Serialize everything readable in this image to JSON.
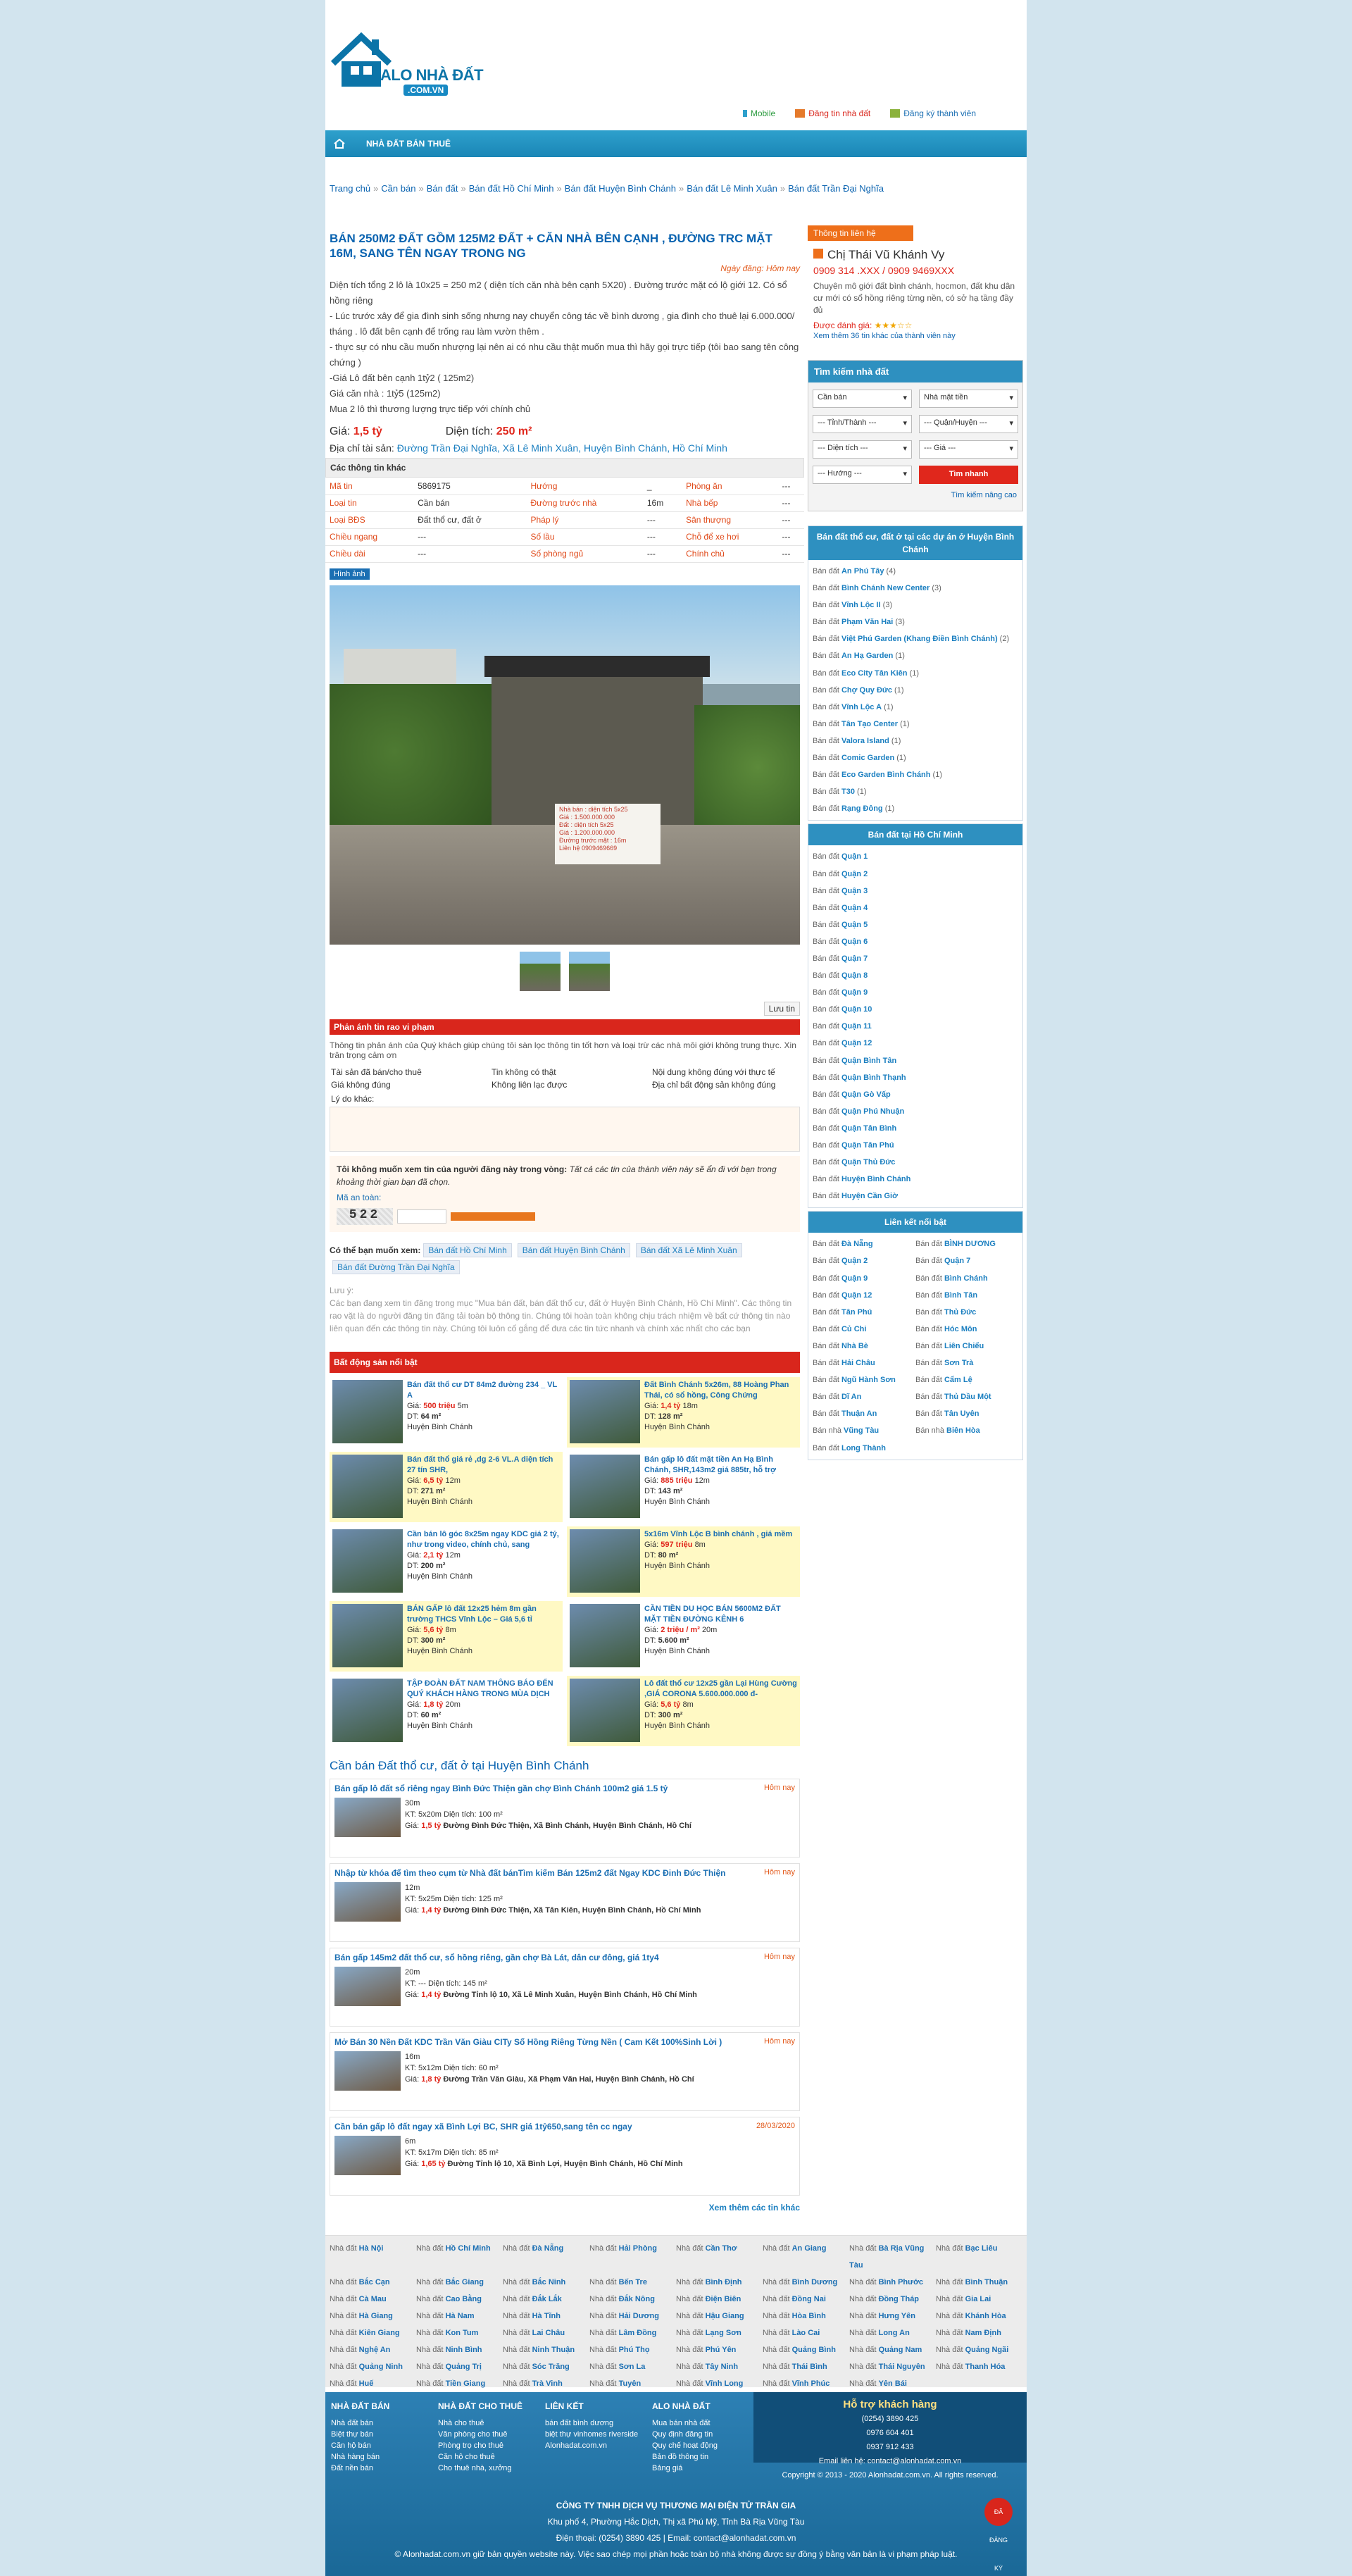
{
  "header": {
    "logo_top": "ALO NHÀ ĐẤT",
    "logo_bottom": ".COM.VN",
    "links": [
      "Mobile",
      "Đăng tin nhà đất",
      "Đăng ký thành viên"
    ]
  },
  "nav": {
    "home_icon": "home-icon",
    "items": [
      "NHÀ ĐẤT BÁN",
      "THUÊ"
    ]
  },
  "breadcrumb": [
    "Trang chủ",
    "Cần bán",
    "Bán đất",
    "Bán đất Hồ Chí Minh",
    "Bán đất Huyện Bình Chánh",
    "Bán đất Lê Minh Xuân",
    "Bán đất Trần Đại Nghĩa"
  ],
  "listing": {
    "title": "BÁN 250M2 ĐẤT GỒM 125M2 ĐẤT + CĂN NHÀ BÊN CẠNH , ĐƯỜNG TRC MẶT 16M, SANG TÊN NGAY TRONG NG",
    "date": "Ngày đăng: Hôm nay",
    "desc": [
      "Diện tích tổng 2 lô là 10x25 = 250 m2 ( diện tích căn nhà bên cạnh 5X20) . Đường trước mặt có lộ giới 12. Có sổ hồng riêng",
      "- Lúc trước xây để gia đình sinh sống nhưng nay chuyển công tác về bình dương , gia đình cho thuê lại 6.000.000/ tháng . lô đất bên cạnh để trống rau làm vườn thêm .",
      "- thực sự có nhu cầu muốn nhượng lại nên ai có nhu cầu thật muốn mua thì hãy gọi trực tiếp (tôi bao sang tên công chứng )",
      "-Giá Lô đất bên cạnh 1tỷ2 ( 125m2)",
      "Giá căn nhà : 1tỷ5 (125m2)",
      "Mua 2 lô thì thương lượng trực tiếp với chính chủ"
    ],
    "price_label": "Giá:",
    "price": "1,5 tỷ",
    "area_label": "Diện tích:",
    "area": "250 m²",
    "addr_label": "Địa chỉ tài sản:",
    "addr": "Đường Trần Đại Nghĩa, Xã Lê Minh Xuân, Huyện Bình Chánh, Hồ Chí Minh",
    "info_title": "Các thông tin khác",
    "info": [
      [
        "Mã tin",
        "5869175",
        "Hướng",
        "_",
        "Phòng ăn",
        "---"
      ],
      [
        "Loại tin",
        "Cần bán",
        "Đường trước nhà",
        "16m",
        "Nhà bếp",
        "---"
      ],
      [
        "Loại BĐS",
        "Đất thổ cư, đất ở",
        "Pháp lý",
        "---",
        "Sân thượng",
        "---"
      ],
      [
        "Chiều ngang",
        "---",
        "Số lầu",
        "---",
        "Chỗ để xe hơi",
        "---"
      ],
      [
        "Chiều dài",
        "---",
        "Số phòng ngủ",
        "---",
        "Chính chủ",
        "---"
      ]
    ],
    "photo_label": "Hình ảnh",
    "sign": [
      "Nhà bán : diện tích 5x25",
      "Giá : 1.500.000.000",
      "Đất : diện tích 5x25",
      "Giá : 1.200.000.000",
      "Đường trước mặt : 16m",
      "Liên hệ 0909469669"
    ],
    "save": "Lưu tin"
  },
  "report": {
    "title": "Phản ánh tin rao vi phạm",
    "intro": "Thông tin phản ánh của Quý khách giúp chúng tôi sàn lọc thông tin tốt hơn và loại trừ các nhà môi giới không trung thực. Xin trân trọng cảm ơn",
    "options": [
      "Tài sản đã bán/cho thuê",
      "Tin không có thật",
      "Nội dung không đúng với thực tế",
      "Giá không đúng",
      "Không liên lạc được",
      "Địa chỉ bất động sản không đúng"
    ],
    "reason_label": "Lý do khác:",
    "block_title": "Tôi không muốn xem tin của người đăng này trong vòng:",
    "block_note": "Tất cả các tin của thành viên này sẽ ẩn đi với bạn trong khoảng thời gian bạn đã chọn.",
    "cap_label": "Mã an toàn:",
    "cap": "522"
  },
  "seealso": {
    "label": "Có thể bạn muốn xem:",
    "tags": [
      "Bán đất Hồ Chí Minh",
      "Bán đất Huyện Bình Chánh",
      "Bán đất Xã Lê Minh Xuân",
      "Bán đất Đường Trần Đại Nghĩa"
    ]
  },
  "note": {
    "title": "Lưu ý:",
    "text": "Các bạn đang xem tin đăng trong mục \"Mua bán đất, bán đất thổ cư, đất ở Huyện Bình Chánh, Hồ Chí Minh\". Các thông tin rao vặt là do người đăng tin đăng tải toàn bộ thông tin. Chúng tôi hoàn toàn không chịu trách nhiệm về bất cứ thông tin nào liên quan đến các thông tin này. Chúng tôi luôn cố gắng để đưa các tin tức nhanh và chính xác nhất cho các bạn"
  },
  "hot": {
    "title": "Bất động sản nổi bật",
    "items": [
      {
        "t": "Bán đất thổ cư DT 84m2 đường 234 _ VL A",
        "p": "500 triệu",
        "a": "64 m²",
        "s": "5m",
        "l": "Huyện Bình Chánh",
        "y": false
      },
      {
        "t": "Đất Bình Chánh 5x26m, 88 Hoàng Phan Thái, có sổ hồng, Công Chứng",
        "p": "1,4 tỷ",
        "a": "128 m²",
        "s": "18m",
        "l": "Huyện Bình Chánh",
        "y": true
      },
      {
        "t": "Bán đất thổ giá rẻ ,dg 2-6 VL.A diện tích 27 tín SHR,",
        "p": "6,5 tỷ",
        "a": "271 m²",
        "s": "12m",
        "l": "Huyện Bình Chánh",
        "y": true
      },
      {
        "t": "Bán gấp lô đất mặt tiền An Hạ Bình Chánh, SHR,143m2 giá 885tr, hỗ trợ",
        "p": "885 triệu",
        "a": "143 m²",
        "s": "12m",
        "l": "Huyện Bình Chánh",
        "y": false
      },
      {
        "t": "Cần bán lô góc 8x25m ngay KDC giá 2 tỷ, như trong video, chính chủ, sang",
        "p": "2,1 tỷ",
        "a": "200 m²",
        "s": "12m",
        "l": "Huyện Bình Chánh",
        "y": false
      },
      {
        "t": "5x16m Vĩnh Lộc B bình chánh , giá mềm",
        "p": "597 triệu",
        "a": "80 m²",
        "s": "8m",
        "l": "Huyện Bình Chánh",
        "y": true
      },
      {
        "t": "BÁN GẤP lô đất 12x25 hẻm 8m gần trường THCS Vĩnh Lộc – Giá 5,6 tỉ",
        "p": "5,6 tỷ",
        "a": "300 m²",
        "s": "8m",
        "l": "Huyện Bình Chánh",
        "y": true
      },
      {
        "t": "CẦN TIỀN DU HỌC BÁN 5600M2 ĐẤT MẶT TIỀN ĐƯỜNG KÊNH 6",
        "p": "2 triệu / m²",
        "a": "5.600 m²",
        "s": "20m",
        "l": "Huyện Bình Chánh",
        "y": false
      },
      {
        "t": "TẬP ĐOÀN ĐẤT NAM THÔNG BÁO ĐẾN QUÝ KHÁCH HÀNG TRONG MÙA DỊCH",
        "p": "1,8 tỷ",
        "a": "60 m²",
        "s": "20m",
        "l": "Huyện Bình Chánh",
        "y": false
      },
      {
        "t": "Lô đất thổ cư 12x25 gần Lại Hùng Cường ,GIÁ CORONA 5.600.000.000 đ-",
        "p": "5,6 tỷ",
        "a": "300 m²",
        "s": "8m",
        "l": "Huyện Bình Chánh",
        "y": true
      }
    ]
  },
  "recent": {
    "title": "Cần bán Đất thổ cư, đất ở tại Huyện Bình Chánh",
    "items": [
      {
        "t": "Bán gấp lô đất sổ riêng ngay Bình Đức Thiện gần chợ Bình Chánh 100m2 giá 1.5 tỷ",
        "d": "Hôm nay",
        "kt": "5x20m",
        "dt": "100 m²",
        "g": "1,5 tỷ",
        "f": "30m",
        "h": "_",
        "addr": "Đường Đình Đức Thiện, Xã Bình Chánh, Huyện Bình Chánh, Hồ Chí"
      },
      {
        "t": "Nhập từ khóa để tìm theo cụm từ Nhà đất bánTìm kiếm Bán 125m2 đất Ngay KDC Đinh Đức Thiện",
        "d": "Hôm nay",
        "kt": "5x25m",
        "dt": "125 m²",
        "g": "1,4 tỷ",
        "f": "12m",
        "h": "_",
        "addr": "Đường Đinh Đức Thiện, Xã Tân Kiên, Huyện Bình Chánh, Hồ Chí Minh"
      },
      {
        "t": "Bán gấp 145m2 đất thổ cư, sổ hồng riêng, gần chợ Bà Lát, dân cư đông, giá 1ty4",
        "d": "Hôm nay",
        "kt": "---",
        "dt": "145 m²",
        "g": "1,4 tỷ",
        "f": "20m",
        "h": "_",
        "addr": "Đường Tỉnh lộ 10, Xã Lê Minh Xuân, Huyện Bình Chánh, Hồ Chí Minh"
      },
      {
        "t": "Mở Bán 30 Nền Đất KDC Trần Văn Giàu CITy Sổ Hồng Riêng Từng Nền ( Cam Kết 100%Sinh Lời )",
        "d": "Hôm nay",
        "kt": "5x12m",
        "dt": "60 m²",
        "g": "1,8 tỷ",
        "f": "16m",
        "h": "_",
        "addr": "Đường Trần Văn Giàu, Xã Phạm Văn Hai, Huyện Bình Chánh, Hồ Chí"
      },
      {
        "t": "Cần bán gấp lô đất ngay xã Bình Lợi BC, SHR giá 1tỷ650,sang tên cc ngay",
        "d": "28/03/2020",
        "kt": "5x17m",
        "dt": "85 m²",
        "g": "1,65 tỷ",
        "f": "6m",
        "h": "_",
        "addr": "Đường Tỉnh lộ 10, Xã Bình Lợi, Huyện Bình Chánh, Hồ Chí Minh"
      }
    ],
    "more": "Xem thêm các tin khác"
  },
  "cities": [
    "Hà Nội",
    "Hồ Chí Minh",
    "Đà Nẵng",
    "Hải Phòng",
    "Cần Thơ",
    "An Giang",
    "Bà Rịa Vũng Tàu",
    "Bạc Liêu",
    "Bắc Cạn",
    "Bắc Giang",
    "Bắc Ninh",
    "Bến Tre",
    "Bình Định",
    "Bình Dương",
    "Bình Phước",
    "Bình Thuận",
    "Cà Mau",
    "Cao Bằng",
    "Đắk Lắk",
    "Đắk Nông",
    "Điện Biên",
    "Đồng Nai",
    "Đồng Tháp",
    "Gia Lai",
    "Hà Giang",
    "Hà Nam",
    "Hà Tĩnh",
    "Hải Dương",
    "Hậu Giang",
    "Hòa Bình",
    "Hưng Yên",
    "Khánh Hòa",
    "Kiên Giang",
    "Kon Tum",
    "Lai Châu",
    "Lâm Đồng",
    "Lạng Sơn",
    "Lào Cai",
    "Long An",
    "Nam Định",
    "Nghệ An",
    "Ninh Bình",
    "Ninh Thuận",
    "Phú Thọ",
    "Phú Yên",
    "Quảng Bình",
    "Quảng Nam",
    "Quảng Ngãi",
    "Quảng Ninh",
    "Quảng Trị",
    "Sóc Trăng",
    "Sơn La",
    "Tây Ninh",
    "Thái Bình",
    "Thái Nguyên",
    "Thanh Hóa",
    "Huế",
    "Tiền Giang",
    "Trà Vinh",
    "Tuyên",
    "Vĩnh Long",
    "Vĩnh Phúc",
    "Yên Bái"
  ],
  "footer": {
    "cols": [
      {
        "h": "NHÀ ĐẤT BÁN",
        "items": [
          "Nhà đất bán",
          "Biệt thự bán",
          "Căn hộ bán",
          "Nhà hàng bán",
          "Đất nền bán"
        ]
      },
      {
        "h": "NHÀ ĐẤT CHO THUÊ",
        "items": [
          "Nhà cho thuê",
          "Văn phòng cho thuê",
          "Phòng trọ cho thuê",
          "Căn hộ cho thuê",
          "Cho thuê nhà, xưởng"
        ]
      },
      {
        "h": "LIÊN KẾT",
        "items": [
          "bán đất bình dương",
          "biệt thự vinhomes riverside",
          "Alonhadat.com.vn"
        ]
      },
      {
        "h": "ALO NHÀ ĐẤT",
        "items": [
          "Mua bán nhà đất",
          "Quy định đăng tin",
          "Quy chế hoạt động",
          "Bản đồ thông tin",
          "Bảng giá"
        ]
      }
    ],
    "support": {
      "title": "Hỗ trợ khách hàng",
      "phones": [
        "(0254) 3890 425",
        "0976 604 401",
        "0937 912 433"
      ],
      "email": "Email liên hệ: contact@alonhadat.com.vn",
      "copy": "Copyright © 2013 - 2020 Alonhadat.com.vn. All rights reserved."
    },
    "company": [
      "CÔNG TY TNHH DỊCH VỤ THƯƠNG MẠI ĐIỆN TỬ TRẦN GIA",
      "Khu phố 4, Phường Hắc Dịch, Thị xã Phú Mỹ, Tỉnh Bà Rịa Vũng Tàu",
      "Điện thoại: (0254) 3890 425 | Email: contact@alonhadat.com.vn",
      "© Alonhadat.com.vn giữ bản quyền website này. Việc sao chép mọi phần hoặc toàn bộ nhà không được sự đồng ý bằng văn bản là vi phạm pháp luật."
    ],
    "bct": "ĐÃ ĐĂNG KÝ"
  },
  "side": {
    "contact_head": "Thông tin liên hệ",
    "name": "Chị Thái Vũ Khánh Vy",
    "phone": "0909 314 .XXX / 0909 9469XXX",
    "intro": "Chuyên mô giới đất bình chánh, hocmon, đất khu dân cư mới có sổ hồng riêng từng nền, có sở hạ tầng đầy đủ",
    "rating": "Được đánh giá:",
    "more": "Xem thêm 36 tin khác của thành viên này",
    "search_head": "Tìm kiếm nhà đất",
    "search_sel": [
      "Cần bán",
      "Nhà mặt tiền",
      "--- Tỉnh/Thành ---",
      "--- Quận/Huyện ---",
      "--- Diện tích ---",
      "--- Giá ---",
      "--- Hướng ---"
    ],
    "search_btn": "Tìm nhanh",
    "search_adv": "Tìm kiếm nâng cao",
    "proj_head": "Bán đất thổ cư, đất ở tại các dự án ở Huyện Bình Chánh",
    "proj": [
      [
        "An Phú Tây",
        "4"
      ],
      [
        "Bình Chánh New Center",
        "3"
      ],
      [
        "Vĩnh Lộc II",
        "3"
      ],
      [
        "Phạm Văn Hai",
        "3"
      ],
      [
        "Việt Phú Garden (Khang Điền Bình Chánh)",
        "2"
      ],
      [
        "An Hạ Garden",
        "1"
      ],
      [
        "Eco City Tân Kiên",
        "1"
      ],
      [
        "Chợ Quy Đức",
        "1"
      ],
      [
        "Vĩnh Lộc A",
        "1"
      ],
      [
        "Tân Tạo Center",
        "1"
      ],
      [
        "Valora Island",
        "1"
      ],
      [
        "Comic Garden",
        "1"
      ],
      [
        "Eco Garden Bình Chánh",
        "1"
      ],
      [
        "T30",
        "1"
      ],
      [
        "Rạng Đông",
        "1"
      ]
    ],
    "hcm_head": "Bán đất tại Hồ Chí Minh",
    "hcm": [
      "Quận 1",
      "Quận 2",
      "Quận 3",
      "Quận 4",
      "Quận 5",
      "Quận 6",
      "Quận 7",
      "Quận 8",
      "Quận 9",
      "Quận 10",
      "Quận 11",
      "Quận 12",
      "Quận Bình Tân",
      "Quận Bình Thạnh",
      "Quận Gò Vấp",
      "Quận Phú Nhuận",
      "Quận Tân Bình",
      "Quận Tân Phú",
      "Quận Thủ Đức",
      "Huyện Bình Chánh",
      "Huyện Cần Giờ"
    ],
    "link_head": "Liên kết nổi bật",
    "links": [
      [
        "Bán đất",
        "Đà Nẵng"
      ],
      [
        "Bán đất",
        "BÌNH DƯƠNG"
      ],
      [
        "Bán đất",
        "Quận 2"
      ],
      [
        "Bán đất",
        "Quận 7"
      ],
      [
        "Bán đất",
        "Quận 9"
      ],
      [
        "Bán đất",
        "Bình Chánh"
      ],
      [
        "Bán đất",
        "Quận 12"
      ],
      [
        "Bán đất",
        "Bình Tân"
      ],
      [
        "Bán đất",
        "Tân Phú"
      ],
      [
        "Bán đất",
        "Thủ Đức"
      ],
      [
        "Bán đất",
        "Củ Chi"
      ],
      [
        "Bán đất",
        "Hóc Môn"
      ],
      [
        "Bán đất",
        "Nhà Bè"
      ],
      [
        "Bán đất",
        "Liên Chiểu"
      ],
      [
        "Bán đất",
        "Hải Châu"
      ],
      [
        "Bán đất",
        "Sơn Trà"
      ],
      [
        "Bán đất",
        "Ngũ Hành Sơn"
      ],
      [
        "Bán đất",
        "Cẩm Lệ"
      ],
      [
        "Bán đất",
        "Dĩ An"
      ],
      [
        "Bán đất",
        "Thủ Dầu Một"
      ],
      [
        "Bán đất",
        "Thuận An"
      ],
      [
        "Bán đất",
        "Tân Uyên"
      ],
      [
        "Bán nhà",
        "Vũng Tàu"
      ],
      [
        "Bán nhà",
        "Biên Hòa"
      ],
      [
        "Bán đất",
        "Long Thành"
      ]
    ]
  }
}
